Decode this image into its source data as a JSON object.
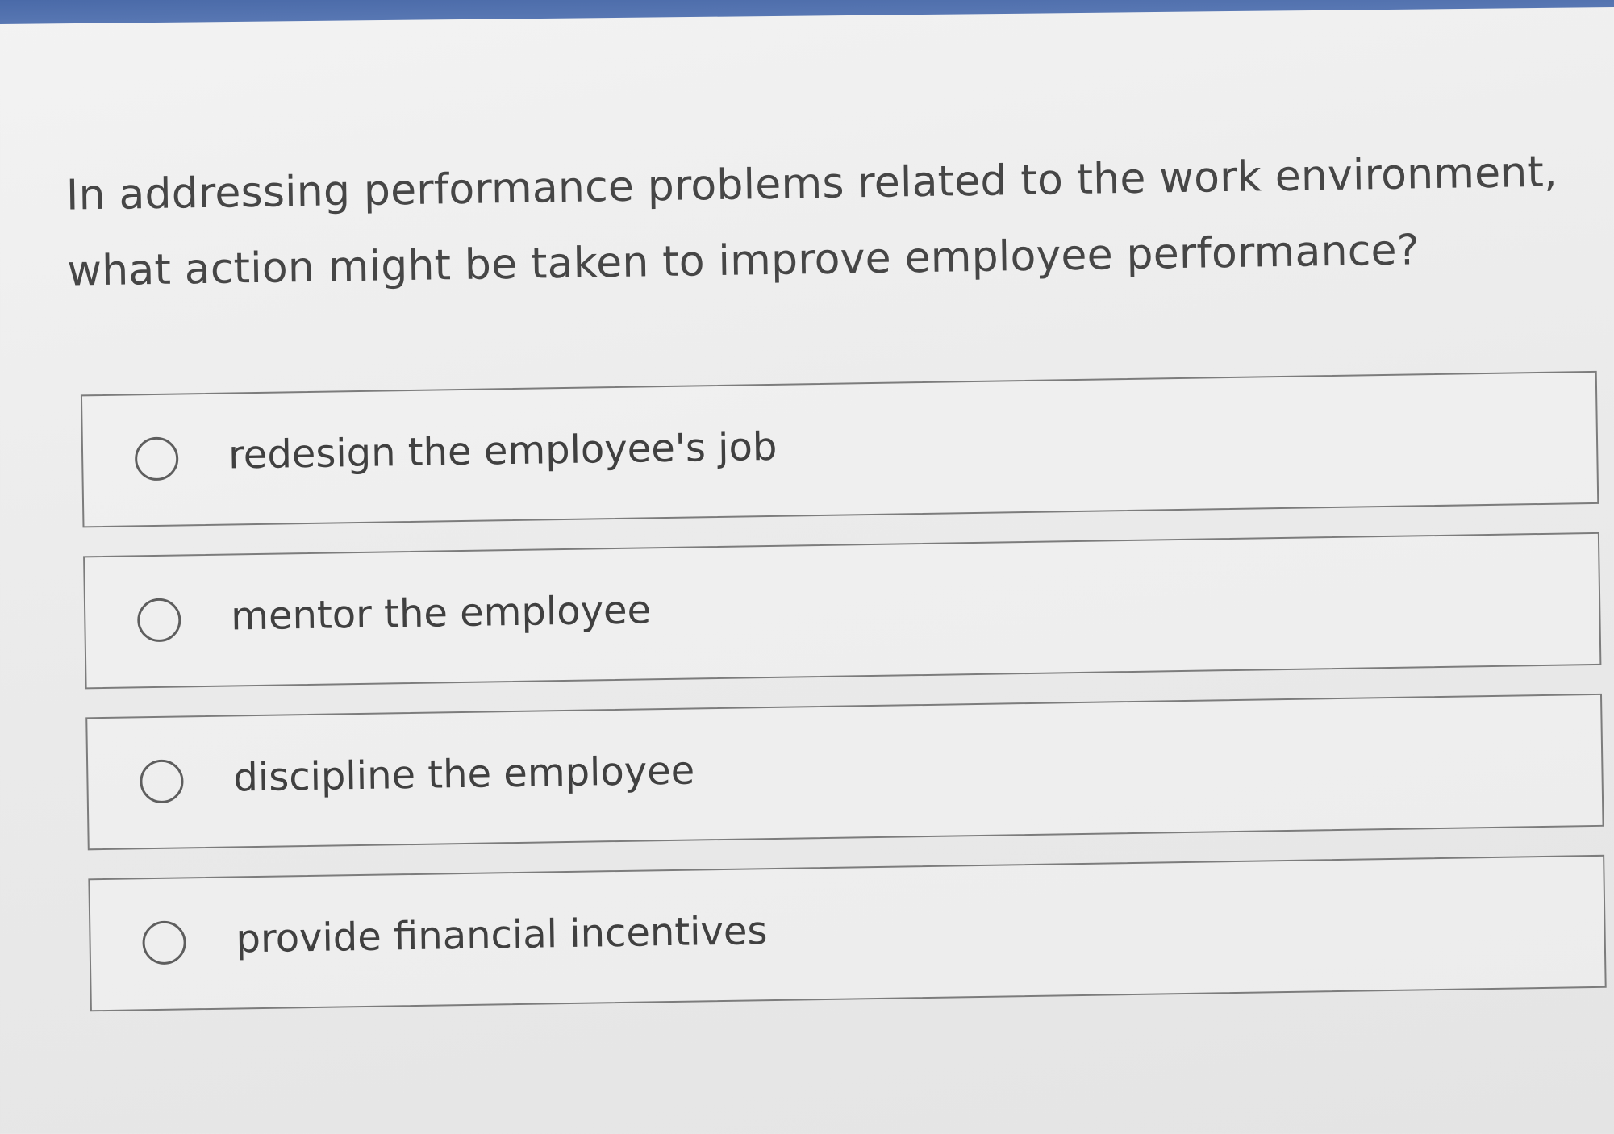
{
  "question": {
    "text": "In addressing performance problems related to the work environment, what action might be taken to improve employee performance?"
  },
  "options": [
    {
      "label": "redesign the employee's job",
      "selected": false
    },
    {
      "label": "mentor the employee",
      "selected": false
    },
    {
      "label": "discipline the employee",
      "selected": false
    },
    {
      "label": "provide financial incentives",
      "selected": false
    }
  ],
  "colors": {
    "top_bar": "#4a6aa8",
    "text": "#464646",
    "border": "#7c7c7c"
  }
}
